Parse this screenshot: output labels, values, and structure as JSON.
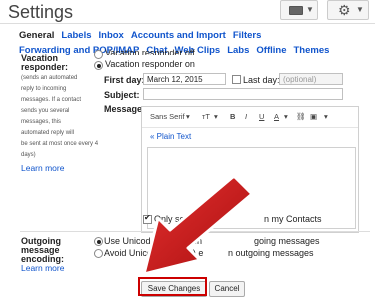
{
  "header": {
    "title": "Settings",
    "keyboard_icon": "keyboard-icon",
    "gear_icon": "gear-icon"
  },
  "tabs": [
    {
      "label": "General",
      "active": true
    },
    {
      "label": "Labels"
    },
    {
      "label": "Inbox"
    },
    {
      "label": "Accounts and Import"
    },
    {
      "label": "Filters"
    },
    {
      "label": "Forwarding and POP/IMAP"
    },
    {
      "label": "Chat"
    },
    {
      "label": "Web Clips"
    },
    {
      "label": "Labs"
    },
    {
      "label": "Offline"
    },
    {
      "label": "Themes"
    }
  ],
  "vacation": {
    "label_line1": "Vacation",
    "label_line2": "responder:",
    "note": [
      "(sends an automated",
      "reply to incoming",
      "messages. If a contact",
      "sends you several",
      "messages, this",
      "automated reply will",
      "be sent at most once every 4",
      "days)"
    ],
    "learn_more": "Learn more",
    "off_label": "Vacation responder off",
    "on_label": "Vacation responder on",
    "first_day_label": "First day:",
    "first_day_value": "March 12, 2015",
    "last_day_label": "Last day:",
    "last_day_placeholder": "(optional)",
    "subject_label": "Subject:",
    "message_label": "Message:",
    "toolbar": {
      "font": "Sans Serif",
      "font_arrow": "▾",
      "size": "тT",
      "size_arrow": "▾",
      "bold": "B",
      "italic": "I",
      "underline": "U",
      "text_color": "A",
      "color_arrow": "▾",
      "link": "⛓",
      "image": "▣",
      "more": "▾"
    },
    "plain_text": "« Plain Text",
    "contacts_only_label_a": "Only send a",
    "contacts_only_label_b": "n my Contacts"
  },
  "outgoing": {
    "label_line1": "Outgoing",
    "label_line2": "message",
    "label_line3": "encoding:",
    "learn_more": "Learn more",
    "option1_a": "Use Unicode (UTF-8) en",
    "option1_b": "going messages",
    "option2_a": "Avoid Unicode (UTF-8) e",
    "option2_b": "n outgoing messages"
  },
  "buttons": {
    "save": "Save Changes",
    "cancel": "Cancel"
  },
  "colors": {
    "link": "#1155cc",
    "highlight": "#cc0000",
    "arrow": "#cc1414"
  }
}
